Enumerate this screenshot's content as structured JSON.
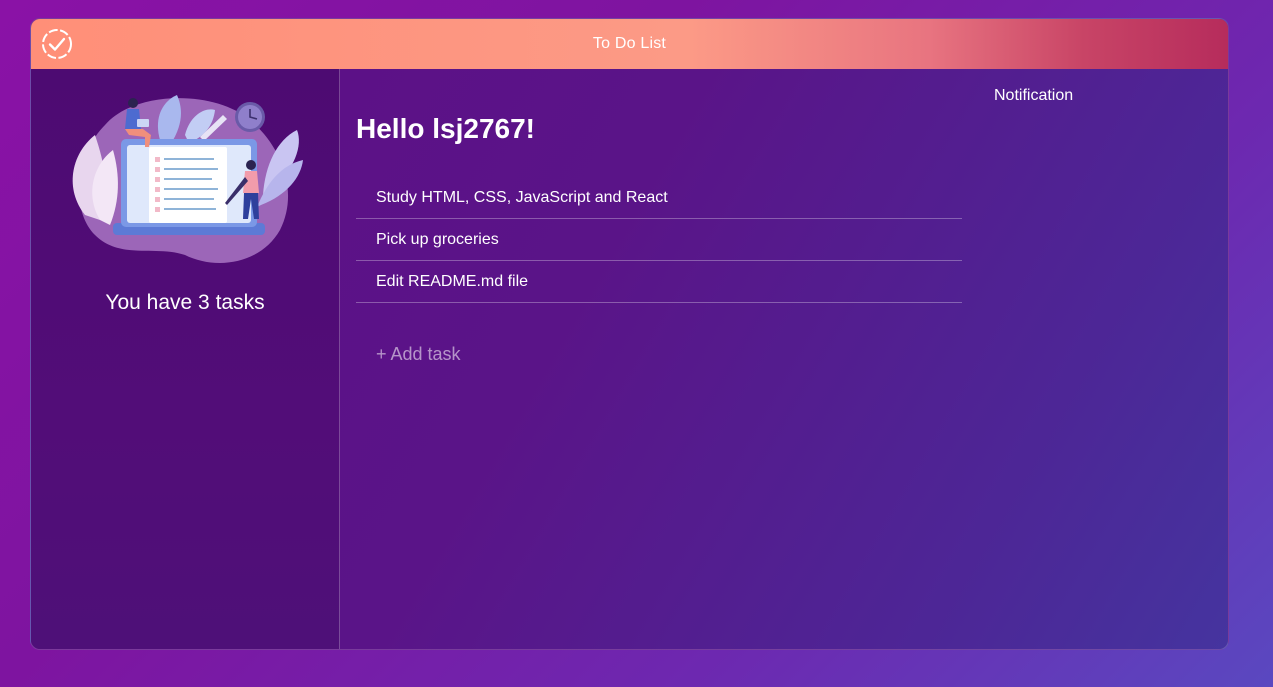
{
  "window": {
    "title": "To Do List"
  },
  "sidebar": {
    "task_count_text": "You have 3 tasks",
    "illustration": "to-do-checklist-illustration"
  },
  "main": {
    "greeting": "Hello lsj2767!",
    "tasks": [
      {
        "label": "Study HTML, CSS, JavaScript and React"
      },
      {
        "label": "Pick up groceries"
      },
      {
        "label": "Edit README.md file"
      }
    ],
    "add_task_label": "+ Add task",
    "notification_label": "Notification"
  },
  "colors": {
    "titlebar_start": "#ff8f78",
    "titlebar_end": "#b62c5c",
    "sidebar_bg": "#4d0b72",
    "page_bg": "#8a12a6"
  }
}
